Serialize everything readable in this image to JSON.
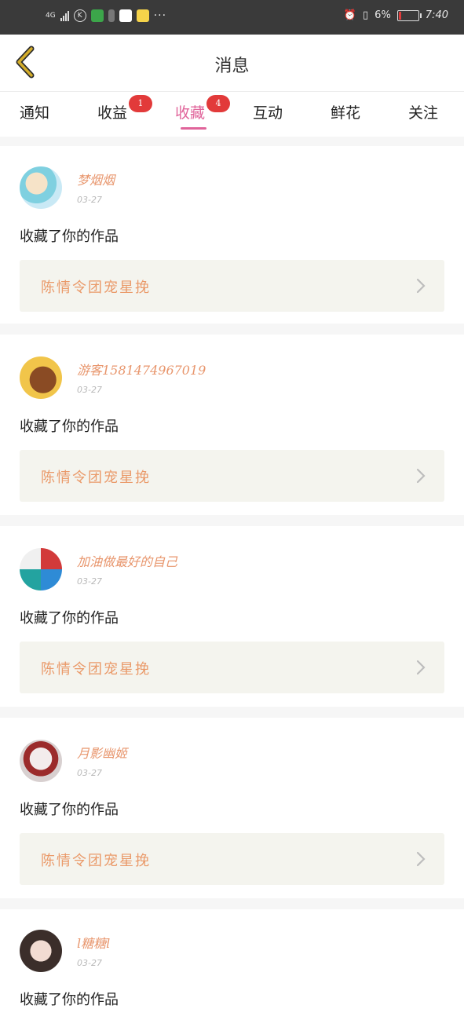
{
  "status_bar": {
    "network": "4G",
    "battery_percent": "6%",
    "time": "7:40",
    "more": "···"
  },
  "header": {
    "title": "消息"
  },
  "tabs": [
    {
      "label": "通知"
    },
    {
      "label": "收益",
      "badge": "1"
    },
    {
      "label": "收藏",
      "badge": "4",
      "active": true
    },
    {
      "label": "互动"
    },
    {
      "label": "鲜花"
    },
    {
      "label": "关注"
    }
  ],
  "messages": [
    {
      "user": "梦烟烟",
      "date": "03-27",
      "action": "收藏了你的作品",
      "work": "陈情令团宠星挽"
    },
    {
      "user": "游客1581474967019",
      "date": "03-27",
      "action": "收藏了你的作品",
      "work": "陈情令团宠星挽"
    },
    {
      "user": "加油做最好的自己",
      "date": "03-27",
      "action": "收藏了你的作品",
      "work": "陈情令团宠星挽"
    },
    {
      "user": "月影幽姬",
      "date": "03-27",
      "action": "收藏了你的作品",
      "work": "陈情令团宠星挽"
    },
    {
      "user": "l糖糖l",
      "date": "03-27",
      "action": "收藏了你的作品",
      "work": ""
    }
  ],
  "colors": {
    "accent": "#e0649a",
    "badge": "#e23a3a",
    "username": "#e8966d",
    "work_title": "#ea9a6a",
    "back_arrow": "#c9a21c"
  }
}
